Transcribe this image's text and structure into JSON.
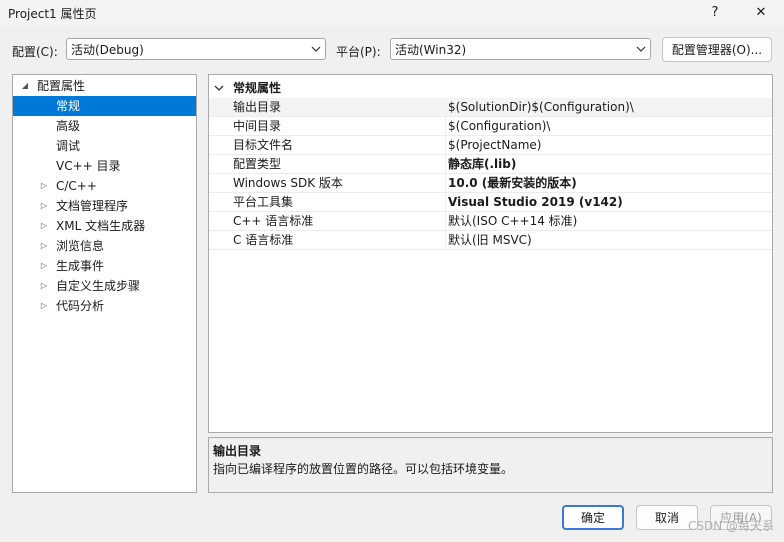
{
  "window": {
    "title": "Project1 属性页",
    "help": "?",
    "close": "✕"
  },
  "config": {
    "config_label": "配置(C):",
    "config_value": "活动(Debug)",
    "platform_label": "平台(P):",
    "platform_value": "活动(Win32)",
    "manager_button": "配置管理器(O)..."
  },
  "tree": {
    "root": "配置属性",
    "items": [
      "常规",
      "高级",
      "调试",
      "VC++ 目录"
    ],
    "collapsed": [
      "C/C++",
      "文档管理程序",
      "XML 文档生成器",
      "浏览信息",
      "生成事件",
      "自定义生成步骤",
      "代码分析"
    ]
  },
  "grid": {
    "section": "常规属性",
    "rows": [
      {
        "name": "输出目录",
        "value": "$(SolutionDir)$(Configuration)\\",
        "bold": false
      },
      {
        "name": "中间目录",
        "value": "$(Configuration)\\",
        "bold": false
      },
      {
        "name": "目标文件名",
        "value": "$(ProjectName)",
        "bold": false
      },
      {
        "name": "配置类型",
        "value": "静态库(.lib)",
        "bold": true
      },
      {
        "name": "Windows SDK 版本",
        "value": "10.0 (最新安装的版本)",
        "bold": true
      },
      {
        "name": "平台工具集",
        "value": "Visual Studio 2019 (v142)",
        "bold": true
      },
      {
        "name": "C++ 语言标准",
        "value": "默认(ISO C++14 标准)",
        "bold": false
      },
      {
        "name": "C 语言标准",
        "value": "默认(旧 MSVC)",
        "bold": false
      }
    ]
  },
  "description": {
    "title": "输出目录",
    "text": "指向已编译程序的放置位置的路径。可以包括环境变量。"
  },
  "buttons": {
    "ok": "确定",
    "cancel": "取消",
    "apply": "应用(A)"
  },
  "watermark": "CSDN @每天系"
}
